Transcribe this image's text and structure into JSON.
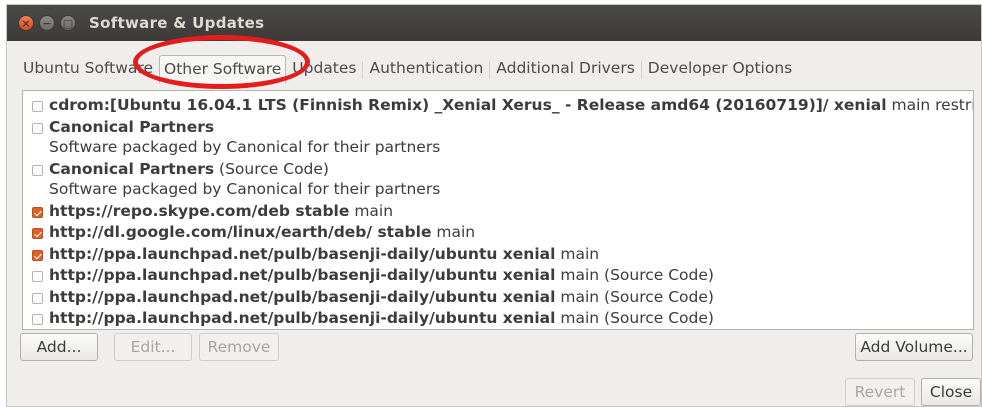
{
  "window": {
    "title": "Software & Updates"
  },
  "titlebar_buttons": {
    "close": "×",
    "minimize": "−",
    "maximize": "□"
  },
  "tabs": [
    {
      "label": "Ubuntu Software"
    },
    {
      "label": "Other Software",
      "active": true
    },
    {
      "label": "Updates"
    },
    {
      "label": "Authentication"
    },
    {
      "label": "Additional Drivers"
    },
    {
      "label": "Developer Options"
    }
  ],
  "sources": [
    {
      "checked": false,
      "bold": "cdrom:[Ubuntu 16.04.1 LTS (Finnish Remix) _Xenial Xerus_ - Release amd64 (20160719)]/ xenial",
      "rest": " main restricted",
      "sub": ""
    },
    {
      "checked": false,
      "bold": "Canonical Partners",
      "rest": "",
      "sub": "Software packaged by Canonical for their partners"
    },
    {
      "checked": false,
      "bold": "Canonical Partners",
      "rest": " (Source Code)",
      "sub": "Software packaged by Canonical for their partners"
    },
    {
      "checked": true,
      "bold": "https://repo.skype.com/deb stable",
      "rest": " main",
      "sub": ""
    },
    {
      "checked": true,
      "bold": "http://dl.google.com/linux/earth/deb/ stable",
      "rest": " main",
      "sub": ""
    },
    {
      "checked": true,
      "bold": "http://ppa.launchpad.net/pulb/basenji-daily/ubuntu xenial",
      "rest": " main",
      "sub": ""
    },
    {
      "checked": false,
      "bold": "http://ppa.launchpad.net/pulb/basenji-daily/ubuntu xenial",
      "rest": " main (Source Code)",
      "sub": ""
    },
    {
      "checked": false,
      "bold": "http://ppa.launchpad.net/pulb/basenji-daily/ubuntu xenial",
      "rest": " main (Source Code)",
      "sub": ""
    },
    {
      "checked": false,
      "bold": "http://ppa.launchpad.net/pulb/basenji-daily/ubuntu xenial",
      "rest": " main (Source Code)",
      "sub": ""
    }
  ],
  "buttons": {
    "add": "Add...",
    "edit": "Edit...",
    "remove": "Remove",
    "add_volume": "Add Volume...",
    "revert": "Revert",
    "close": "Close"
  },
  "colors": {
    "titlebar": "#3c3b37",
    "close_button": "#df4a16",
    "checkbox_checked": "#d9612c",
    "annotation_circle": "#e51c1c"
  }
}
